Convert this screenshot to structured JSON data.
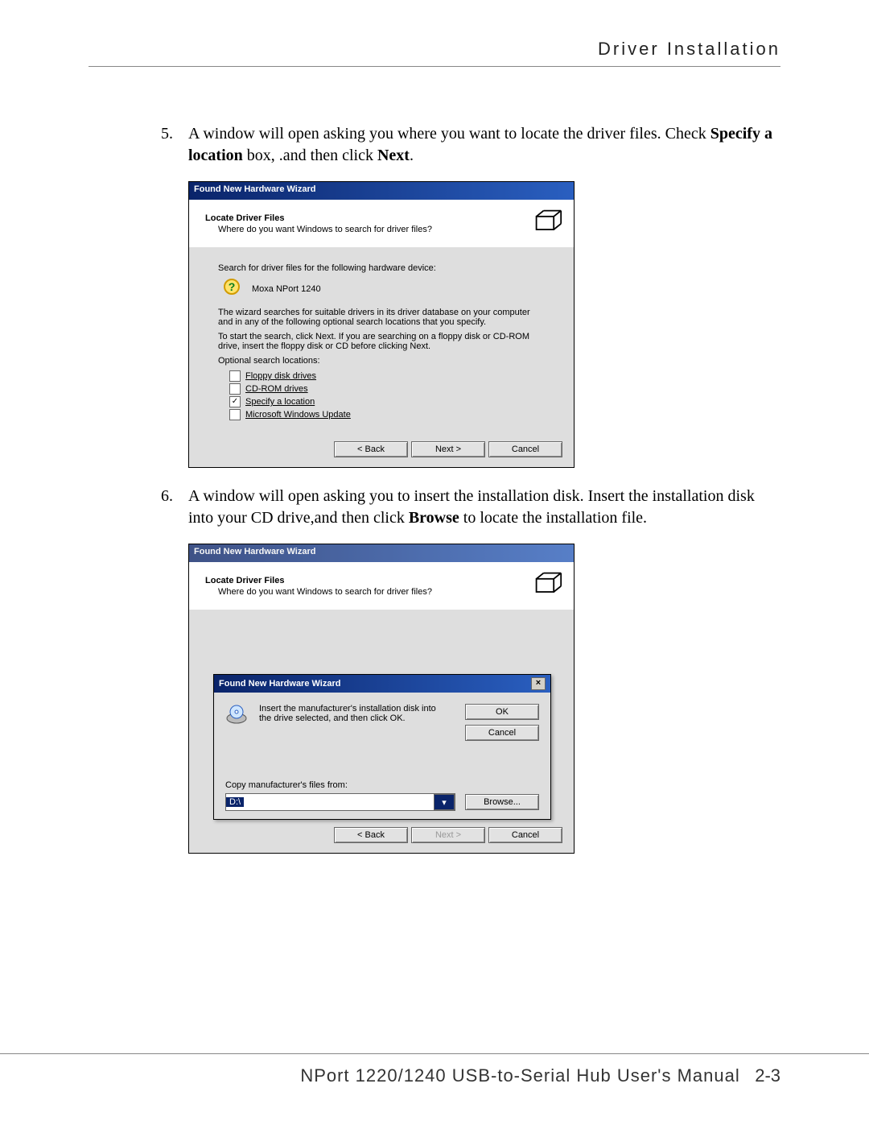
{
  "header": {
    "title": "Driver  Installation"
  },
  "steps": {
    "s5": {
      "num": "5.",
      "text_pre": "A window will open asking you where you want to locate the driver files. Check ",
      "bold1": "Specify a location",
      "text_mid1": " box, .and then click ",
      "bold2": "Next",
      "text_end": "."
    },
    "s6": {
      "num": "6.",
      "text_pre": "A window will open asking you to insert the installation disk. Insert the installation disk into your CD drive,and then click ",
      "bold1": "Browse",
      "text_end": " to locate the installation file."
    }
  },
  "wizard": {
    "title": "Found New Hardware Wizard",
    "subtitle": "Locate Driver Files",
    "subquestion": "Where do you want Windows to search for driver files?",
    "search_label": "Search for driver files for the following hardware device:",
    "device_name": "Moxa NPort 1240",
    "explain1": "The wizard searches for suitable drivers in its driver database on your computer and in any of the following optional search locations that you specify.",
    "explain2": "To start the search, click Next. If you are searching on a floppy disk or CD-ROM drive, insert the floppy disk or CD before clicking Next.",
    "optional_label": "Optional search locations:",
    "opt1": "Floppy disk drives",
    "opt2": "CD-ROM drives",
    "opt3": "Specify a location",
    "opt4": "Microsoft Windows Update",
    "btn_back": "< Back",
    "btn_next": "Next >",
    "btn_cancel": "Cancel"
  },
  "dialog": {
    "title": "Found New Hardware Wizard",
    "msg": "Insert the manufacturer's installation disk into the drive selected, and then click OK.",
    "ok": "OK",
    "cancel": "Cancel",
    "copy_label": "Copy manufacturer's files from:",
    "path": "D:\\",
    "browse": "Browse..."
  },
  "wizard2": {
    "cut_text": "Microsoft Windows Update",
    "btn_back": "< Back",
    "btn_next_disabled": "Next >",
    "btn_cancel": "Cancel"
  },
  "footer": {
    "text": "NPort  1220/1240  USB-to-Serial Hub  User's Manual",
    "page": "2-3"
  }
}
